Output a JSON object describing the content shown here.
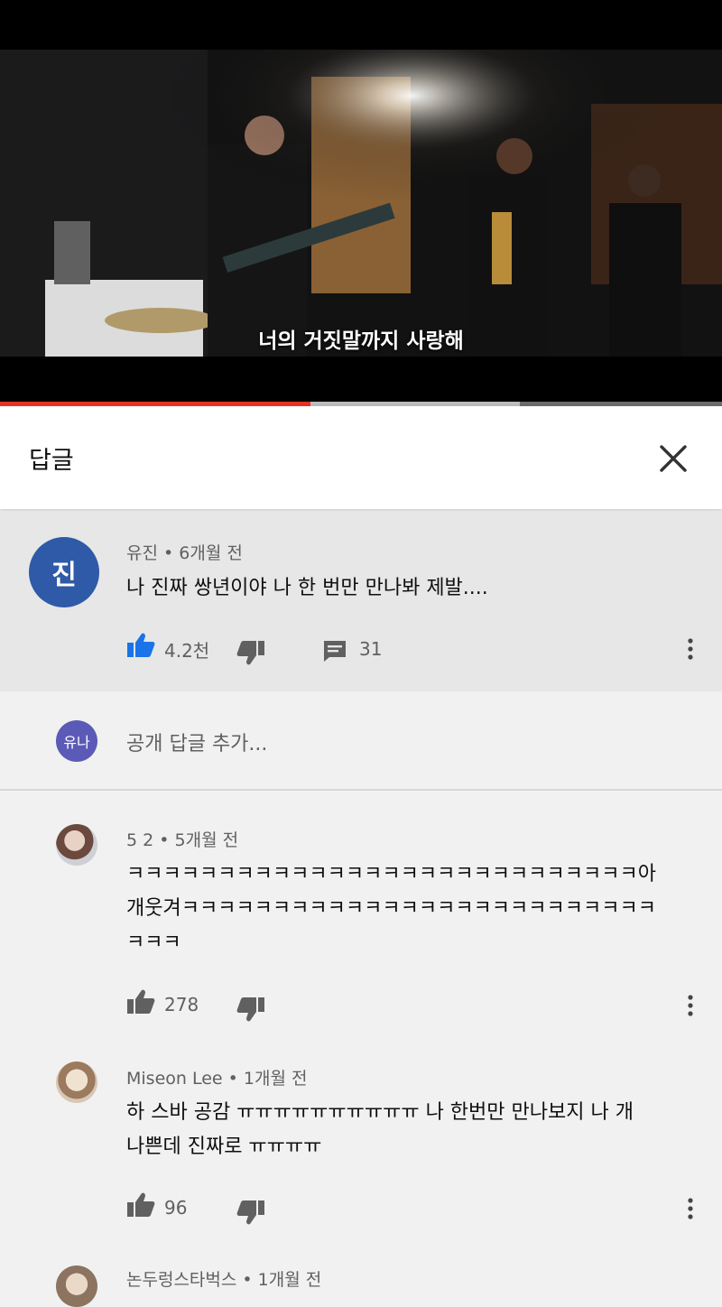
{
  "video": {
    "subtitle": "너의 거짓말까지 사랑해",
    "progress_played": 0.43,
    "progress_buffered": 0.72
  },
  "panel": {
    "title": "답글",
    "close_icon": "close-icon"
  },
  "root_comment": {
    "avatar_initial": "진",
    "author": "유진",
    "time": "6개월 전",
    "text": "나 진짜 쌍년이야 나 한 번만 만나봐 제발....",
    "likes": "4.2천",
    "replies": "31"
  },
  "reply_input": {
    "avatar_label": "유나",
    "placeholder": "공개 답글 추가..."
  },
  "replies": [
    {
      "author": "5 2",
      "time": "5개월 전",
      "lines": [
        "ㅋㅋㅋㅋㅋㅋㅋㅋㅋㅋㅋㅋㅋㅋㅋㅋㅋㅋㅋㅋㅋㅋㅋㅋㅋㅋㅋㅋ아",
        "개웃겨ㅋㅋㅋㅋㅋㅋㅋㅋㅋㅋㅋㅋㅋㅋㅋㅋㅋㅋㅋㅋㅋㅋㅋㅋㅋㅋ",
        "ㅋㅋㅋ"
      ],
      "likes": "278"
    },
    {
      "author": "Miseon Lee",
      "time": "1개월 전",
      "lines": [
        "하 스바 공감 ㅠㅠㅠㅠㅠㅠㅠㅠㅠㅠ 나 한번만 만나보지 나 개",
        "나쁜데 진짜로 ㅠㅠㅠㅠ"
      ],
      "likes": "96"
    },
    {
      "author": "논두렁스타벅스",
      "time": "1개월 전"
    }
  ],
  "colors": {
    "accent_blue": "#1a73e8",
    "progress_red": "#e53323",
    "avatar_blue": "#2e5aa7",
    "avatar_purple": "#5b5ab7"
  }
}
